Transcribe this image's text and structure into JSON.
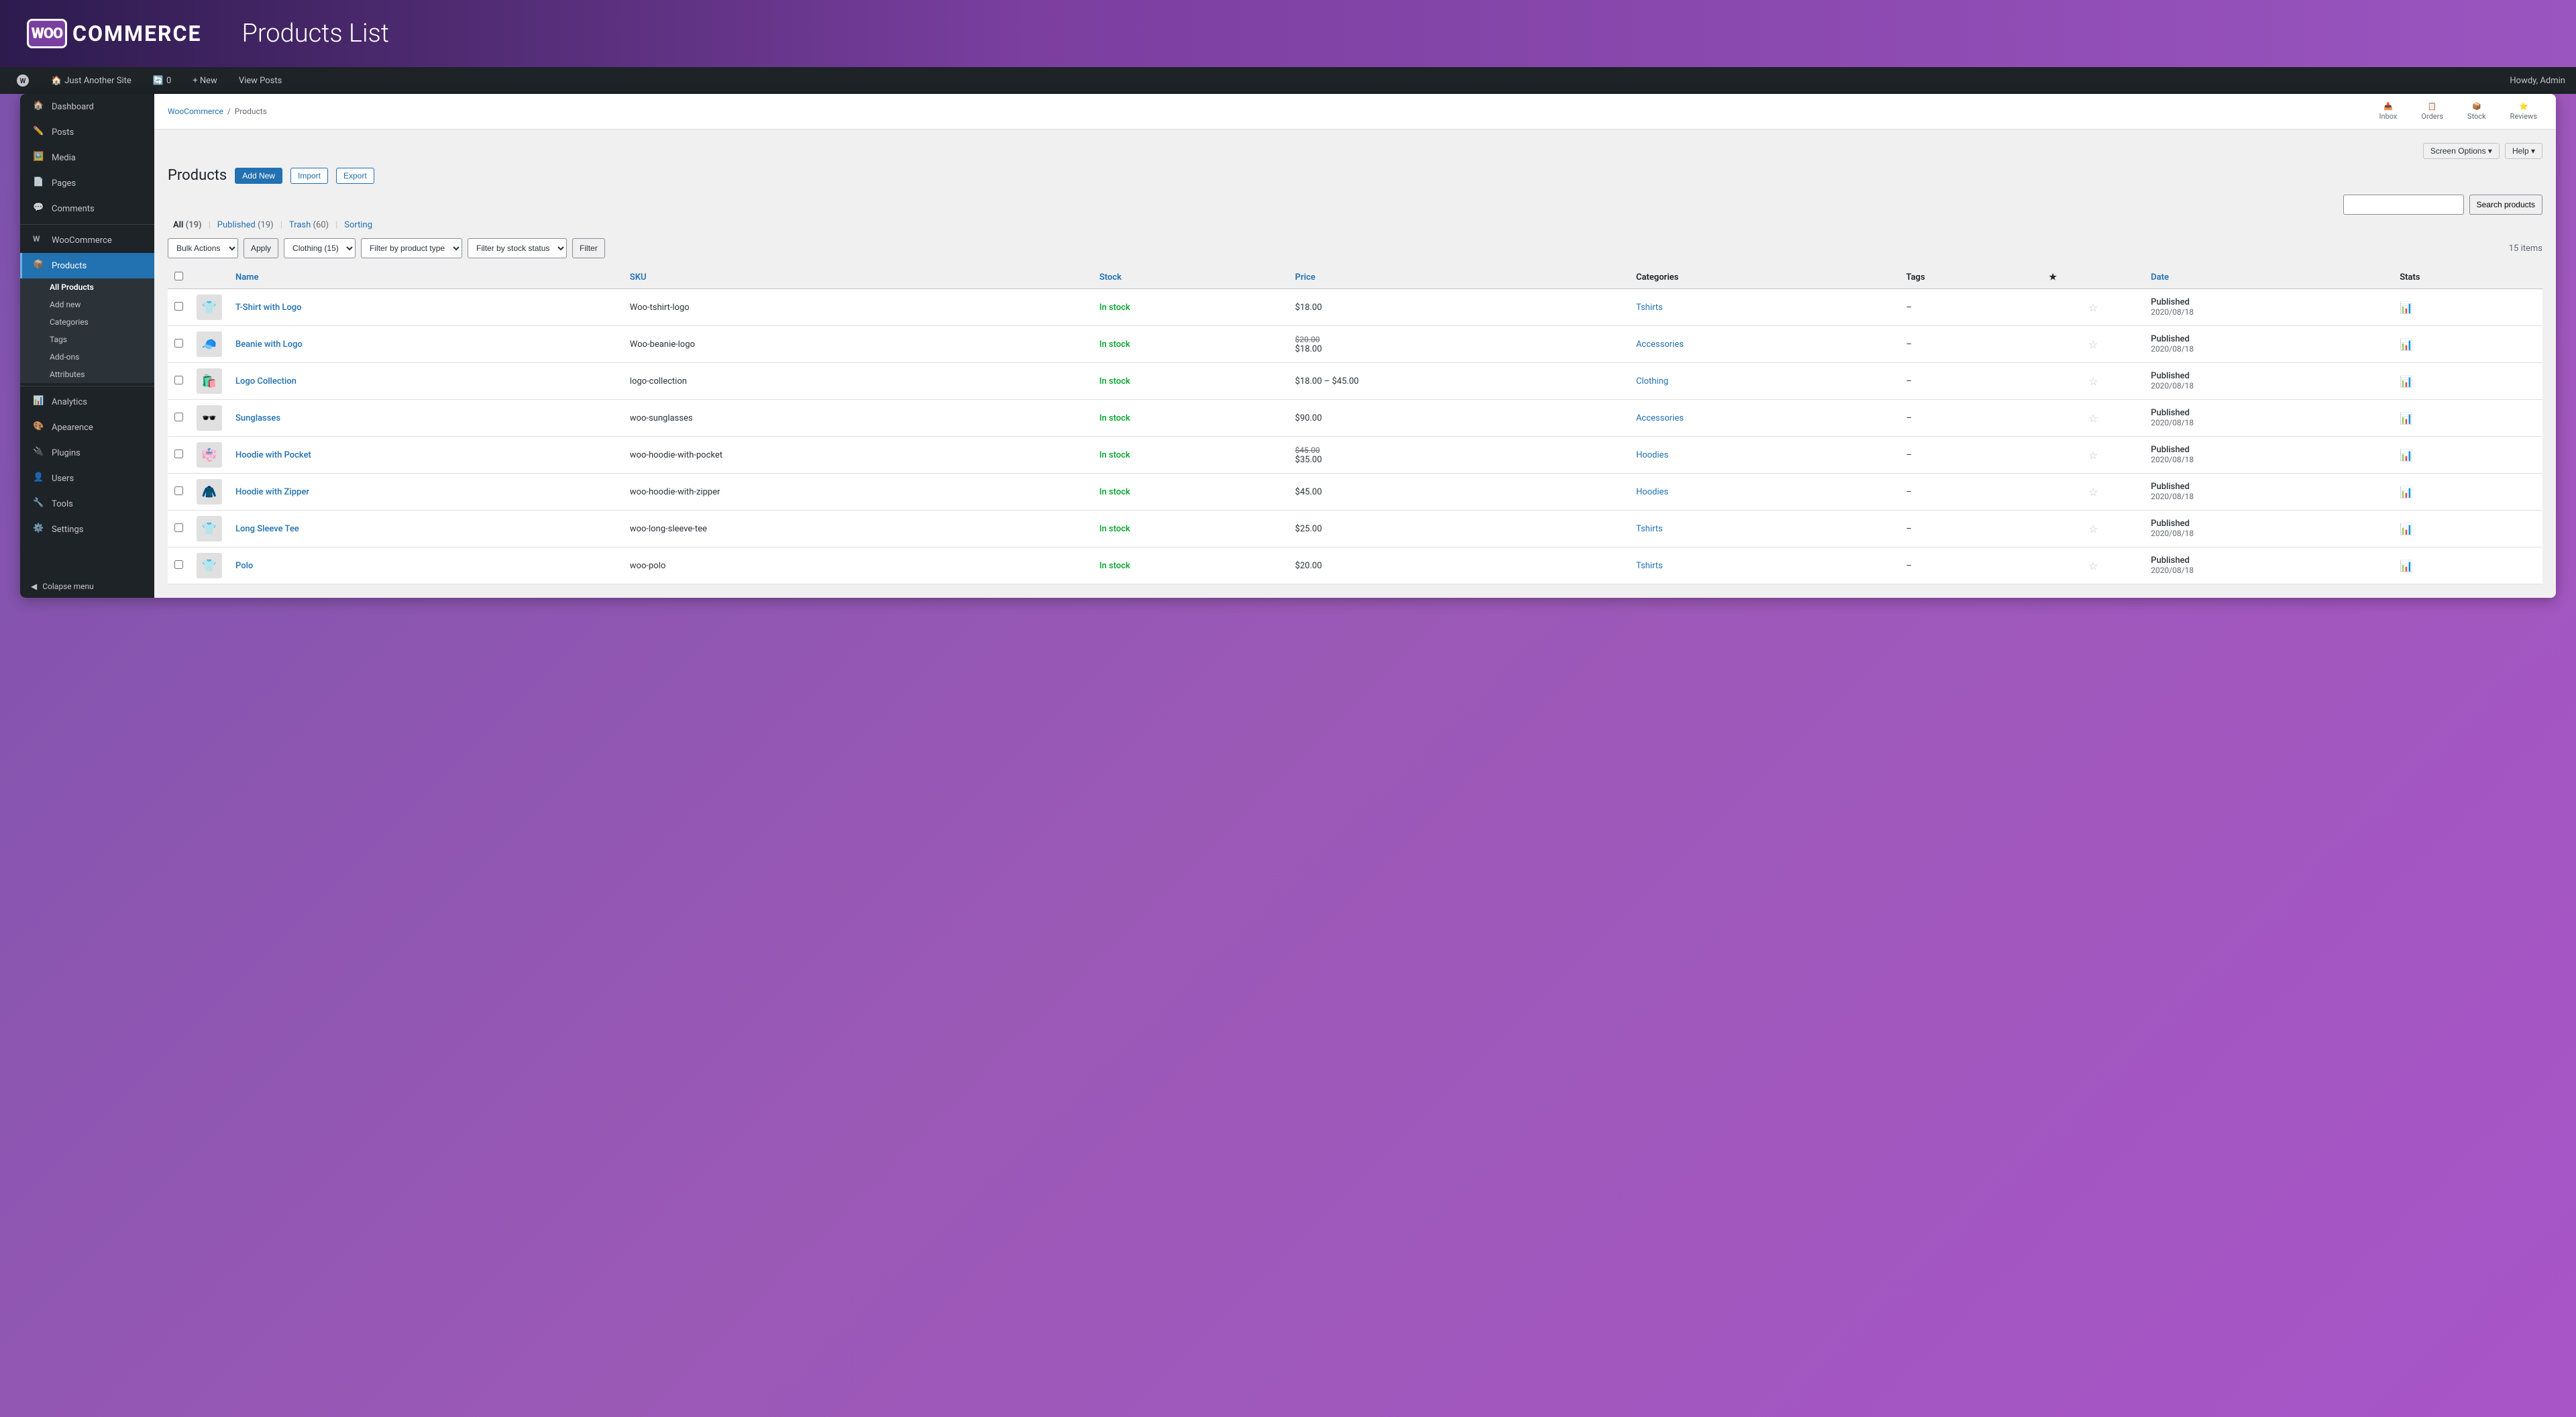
{
  "app": {
    "logo_box": "WOO",
    "logo_text": "COMMERCE",
    "page_title": "Products List"
  },
  "admin_bar": {
    "wp_label": "WordPress",
    "site_name": "Just Another Site",
    "update_count": "0",
    "new_label": "+ New",
    "view_posts": "View Posts",
    "howdy": "Howdy, Admin"
  },
  "toolbar": {
    "inbox": "Inbox",
    "orders": "Orders",
    "stock": "Stock",
    "reviews": "Reviews",
    "screen_options": "Screen Options ▾",
    "help": "Help ▾"
  },
  "breadcrumb": {
    "woocommerce": "WooCommerce",
    "separator": "/",
    "products": "Products"
  },
  "sidebar": {
    "items": [
      {
        "id": "dashboard",
        "label": "Dashboard",
        "icon": "🏠"
      },
      {
        "id": "posts",
        "label": "Posts",
        "icon": "✏️"
      },
      {
        "id": "media",
        "label": "Media",
        "icon": "🖼️"
      },
      {
        "id": "pages",
        "label": "Pages",
        "icon": "📄"
      },
      {
        "id": "comments",
        "label": "Comments",
        "icon": "💬"
      },
      {
        "id": "woocommerce",
        "label": "WooCommerce",
        "icon": "W"
      },
      {
        "id": "products",
        "label": "Products",
        "icon": "📦",
        "active": true
      }
    ],
    "products_submenu": [
      {
        "id": "all-products",
        "label": "All Products",
        "active": true
      },
      {
        "id": "add-new",
        "label": "Add new"
      },
      {
        "id": "categories",
        "label": "Categories"
      },
      {
        "id": "tags",
        "label": "Tags"
      },
      {
        "id": "add-ons",
        "label": "Add-ons"
      },
      {
        "id": "attributes",
        "label": "Attributes"
      }
    ],
    "bottom_items": [
      {
        "id": "analytics",
        "label": "Analytics",
        "icon": "📊"
      },
      {
        "id": "appearance",
        "label": "Apearence",
        "icon": "🎨"
      },
      {
        "id": "plugins",
        "label": "Plugins",
        "icon": "🔌"
      },
      {
        "id": "users",
        "label": "Users",
        "icon": "👤"
      },
      {
        "id": "tools",
        "label": "Tools",
        "icon": "🔧"
      },
      {
        "id": "settings",
        "label": "Settings",
        "icon": "⚙️"
      }
    ],
    "collapse": "Colapse menu"
  },
  "page": {
    "title": "Products",
    "add_new": "Add New",
    "import": "Import",
    "export": "Export"
  },
  "tabs": [
    {
      "id": "all",
      "label": "All",
      "count": "(19)",
      "active": true
    },
    {
      "id": "published",
      "label": "Published",
      "count": "(19)"
    },
    {
      "id": "trash",
      "label": "Trash",
      "count": "(60)"
    },
    {
      "id": "sorting",
      "label": "Sorting"
    }
  ],
  "filters": {
    "bulk_actions": "Bulk Actions",
    "apply": "Apply",
    "clothing_filter": "Clothing (15)",
    "product_type": "Filter by product type",
    "stock_status": "Filter by stock status",
    "filter_btn": "Filter",
    "items_count": "15 items"
  },
  "search": {
    "placeholder": "",
    "button": "Search products"
  },
  "table": {
    "columns": [
      "",
      "",
      "Name",
      "SKU",
      "Stock",
      "Price",
      "Categories",
      "Tags",
      "★",
      "Date",
      "Stats"
    ],
    "rows": [
      {
        "id": 1,
        "name": "T-Shirt with Logo",
        "sku": "Woo-tshirt-logo",
        "stock": "In stock",
        "price": "$18.00",
        "price_orig": "",
        "categories": "Tshirts",
        "tags": "–",
        "starred": false,
        "date": "Published\n2020/08/18",
        "img": "👕"
      },
      {
        "id": 2,
        "name": "Beanie with Logo",
        "sku": "Woo-beanie-logo",
        "stock": "In stock",
        "price": "$18.00",
        "price_orig": "$20.00",
        "categories": "Accessories",
        "tags": "–",
        "starred": false,
        "date": "Published\n2020/08/18",
        "img": "🧢"
      },
      {
        "id": 3,
        "name": "Logo Collection",
        "sku": "logo-collection",
        "stock": "In stock",
        "price": "$18.00 – $45.00",
        "price_orig": "",
        "categories": "Clothing",
        "tags": "–",
        "starred": false,
        "date": "Published\n2020/08/18",
        "img": "🛍️"
      },
      {
        "id": 4,
        "name": "Sunglasses",
        "sku": "woo-sunglasses",
        "stock": "In stock",
        "price": "$90.00",
        "price_orig": "",
        "categories": "Accessories",
        "tags": "–",
        "starred": false,
        "date": "Published\n2020/08/18",
        "img": "🕶️"
      },
      {
        "id": 5,
        "name": "Hoodie with Pocket",
        "sku": "woo-hoodie-with-pocket",
        "stock": "In stock",
        "price": "$35.00",
        "price_orig": "$45.00",
        "categories": "Hoodies",
        "tags": "–",
        "starred": false,
        "date": "Published\n2020/08/18",
        "img": "👘"
      },
      {
        "id": 6,
        "name": "Hoodie with Zipper",
        "sku": "woo-hoodie-with-zipper",
        "stock": "In stock",
        "price": "$45.00",
        "price_orig": "",
        "categories": "Hoodies",
        "tags": "–",
        "starred": false,
        "date": "Published\n2020/08/18",
        "img": "🧥"
      },
      {
        "id": 7,
        "name": "Long Sleeve Tee",
        "sku": "woo-long-sleeve-tee",
        "stock": "In stock",
        "price": "$25.00",
        "price_orig": "",
        "categories": "Tshirts",
        "tags": "–",
        "starred": false,
        "date": "Published\n2020/08/18",
        "img": "👕"
      },
      {
        "id": 8,
        "name": "Polo",
        "sku": "woo-polo",
        "stock": "In stock",
        "price": "$20.00",
        "price_orig": "",
        "categories": "Tshirts",
        "tags": "–",
        "starred": false,
        "date": "Published\n2020/08/18",
        "img": "👕"
      }
    ]
  }
}
